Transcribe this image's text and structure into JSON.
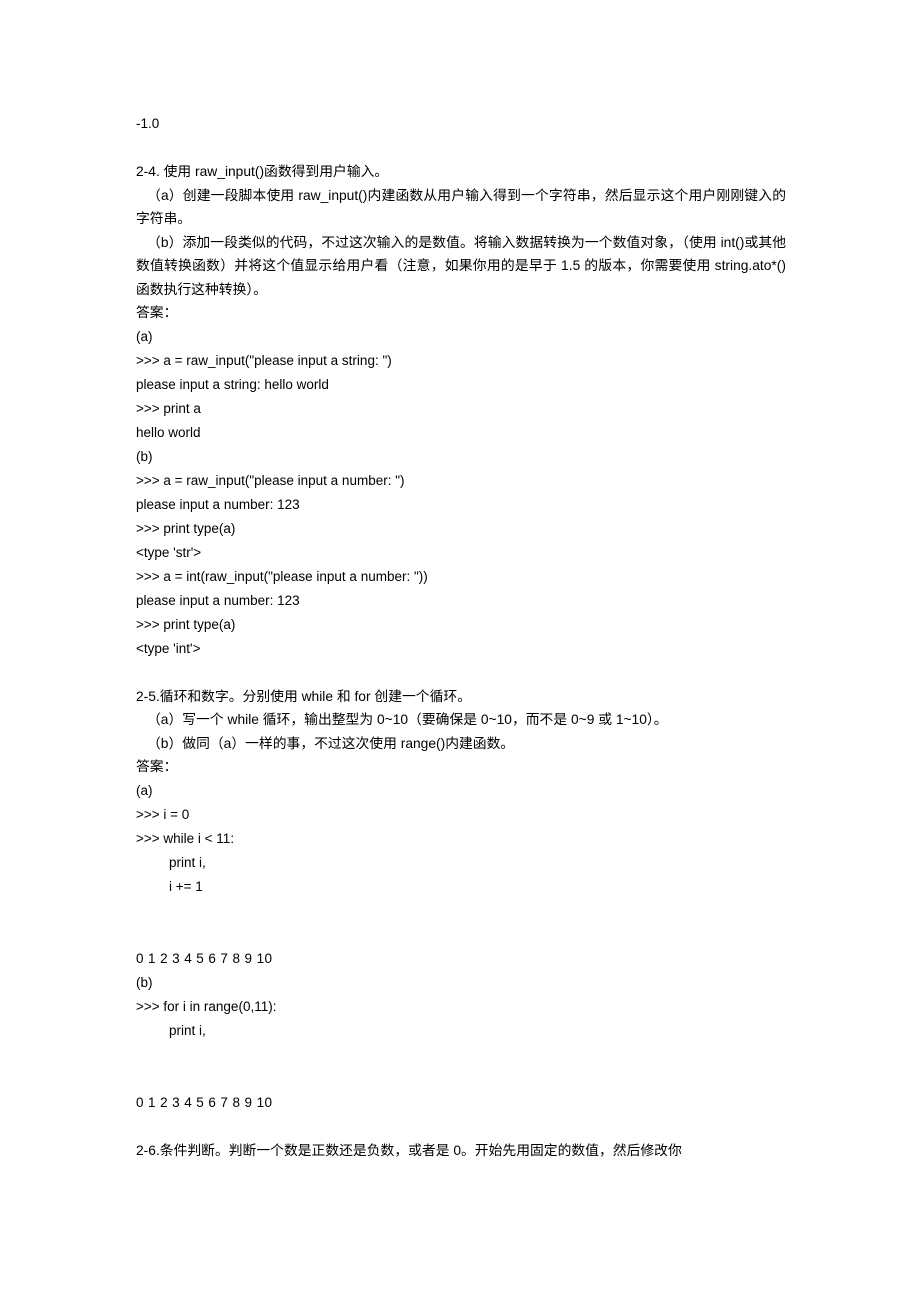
{
  "document": {
    "page_background": "#ffffff",
    "text_color": "#000000",
    "leading_value": "-1.0",
    "sections": [
      {
        "id": "2-4",
        "heading": "2-4. 使用 raw_input()函数得到用户输入。",
        "prompts": [
          "（a）创建一段脚本使用 raw_input()内建函数从用户输入得到一个字符串，然后显示这个用户刚刚键入的字符串。",
          "（b）添加一段类似的代码，不过这次输入的是数值。将输入数据转换为一个数值对象，（使用 int()或其他数值转换函数）并将这个值显示给用户看（注意，如果你用的是早于 1.5 的版本，你需要使用 string.ato*()函数执行这种转换）。"
        ],
        "answer_label": "答案：",
        "parts": [
          {
            "label": "(a)",
            "lines": [
              ">>> a = raw_input(\"please input a string: \")",
              "please input a string: hello world",
              ">>> print a",
              "hello world"
            ]
          },
          {
            "label": "(b)",
            "lines": [
              ">>> a = raw_input(\"please input a number: \")",
              "please input a number: 123",
              ">>> print type(a)",
              "<type 'str'>",
              ">>> a = int(raw_input(\"please input a number: \"))",
              "please input a number: 123",
              ">>> print type(a)",
              "<type 'int'>"
            ]
          }
        ]
      },
      {
        "id": "2-5",
        "heading": "2-5.循环和数字。分别使用 while 和 for 创建一个循环。",
        "prompts": [
          "（a）写一个 while 循环，输出整型为 0~10（要确保是 0~10，而不是 0~9 或 1~10）。",
          "（b）做同（a）一样的事，不过这次使用 range()内建函数。"
        ],
        "answer_label": "答案：",
        "parts": [
          {
            "label": "(a)",
            "lines": [
              ">>> i = 0",
              ">>> while i < 11:"
            ],
            "indented_lines": [
              "print i,",
              "i += 1"
            ],
            "output": "0 1 2 3 4 5 6 7 8 9 10"
          },
          {
            "label": "(b)",
            "lines": [
              ">>> for i in range(0,11):"
            ],
            "indented_lines": [
              "print i,"
            ],
            "output": "0 1 2 3 4 5 6 7 8 9 10"
          }
        ]
      },
      {
        "id": "2-6",
        "heading": "2-6.条件判断。判断一个数是正数还是负数，或者是 0。开始先用固定的数值，然后修改你"
      }
    ]
  }
}
